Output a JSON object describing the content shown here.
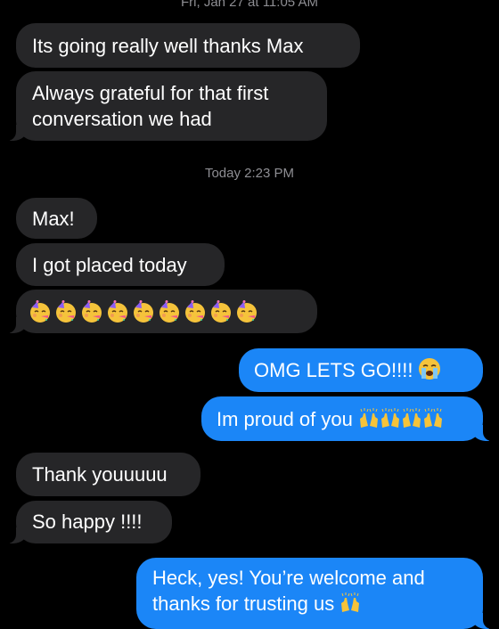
{
  "thread": {
    "timestamp_top": "Fri, Jan 27 at 11:05 AM",
    "timestamp_today": "Today 2:23 PM",
    "messages": [
      {
        "direction": "incoming",
        "lines": [
          "Its going really well thanks Max"
        ]
      },
      {
        "direction": "incoming",
        "lines": [
          "Always grateful for that first",
          "conversation we had"
        ]
      },
      {
        "direction": "incoming",
        "lines": [
          "Max!"
        ]
      },
      {
        "direction": "incoming",
        "lines": [
          "I got placed today"
        ]
      },
      {
        "direction": "incoming",
        "emoji": "partying-face-emoji",
        "emoji_count": 9
      },
      {
        "direction": "outgoing",
        "lines": [
          "OMG LETS GO!!!!"
        ],
        "icon": "loudly-crying-face-emoji"
      },
      {
        "direction": "outgoing",
        "lines": [
          "Im proud of you"
        ],
        "icon": "raising-hands-emoji",
        "icon_count": 4
      },
      {
        "direction": "incoming",
        "lines": [
          "Thank youuuuu"
        ]
      },
      {
        "direction": "incoming",
        "lines": [
          "So happy !!!!"
        ]
      },
      {
        "direction": "outgoing",
        "lines": [
          "Heck, yes! You’re welcome and",
          "thanks for trusting us"
        ],
        "icon": "raising-hands-emoji",
        "icon_count": 1
      }
    ]
  },
  "colors": {
    "background": "#000000",
    "incoming_bubble": "#262628",
    "outgoing_bubble": "#1b86f7",
    "timestamp_text": "#8e8e93"
  }
}
